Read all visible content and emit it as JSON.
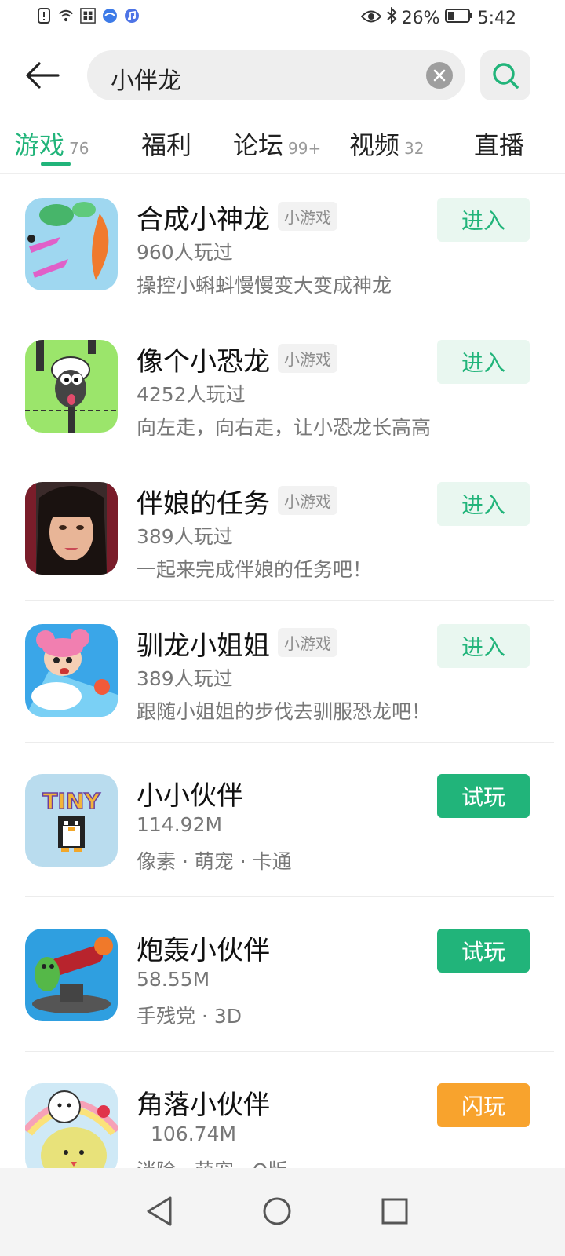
{
  "status": {
    "battery": "26%",
    "time": "5:42",
    "icons": [
      "alert-icon",
      "wifi-icon",
      "game-app-icon",
      "browser-icon",
      "music-icon",
      "eye-icon",
      "bluetooth-icon",
      "battery-icon"
    ]
  },
  "search": {
    "query": "小伴龙",
    "clear_icon": "close-icon",
    "search_icon": "search-icon"
  },
  "tabs": [
    {
      "label": "游戏",
      "count": "76"
    },
    {
      "label": "福利",
      "count": ""
    },
    {
      "label": "论坛",
      "count": "99+"
    },
    {
      "label": "视频",
      "count": "32"
    },
    {
      "label": "直播",
      "count": ""
    }
  ],
  "results": [
    {
      "title": "合成小神龙",
      "tag": "小游戏",
      "meta": "960人玩过",
      "desc": "操控小蝌蚪慢慢变大变成神龙",
      "button": "进入"
    },
    {
      "title": "像个小恐龙",
      "tag": "小游戏",
      "meta": "4252人玩过",
      "desc": "向左走，向右走，让小恐龙长高高",
      "button": "进入"
    },
    {
      "title": "伴娘的任务",
      "tag": "小游戏",
      "meta": "389人玩过",
      "desc": "一起来完成伴娘的任务吧！",
      "button": "进入"
    },
    {
      "title": "驯龙小姐姐",
      "tag": "小游戏",
      "meta": "389人玩过",
      "desc": "跟随小姐姐的步伐去驯服恐龙吧！",
      "button": "进入"
    },
    {
      "title": "小小伙伴",
      "tag": "",
      "meta": "114.92M",
      "desc": "像素 · 萌宠 · 卡通",
      "button": "试玩"
    },
    {
      "title": "炮轰小伙伴",
      "tag": "",
      "meta": "58.55M",
      "desc": "手残党 · 3D",
      "button": "试玩"
    },
    {
      "title": "角落小伙伴",
      "tag": "",
      "meta": "106.74M",
      "desc": "消除 · 萌宠 · Q版",
      "button": "闪玩"
    }
  ],
  "icon_texts": {
    "tiny": "TINY"
  },
  "colors": {
    "accent": "#21b47a",
    "flash": "#f8a32d"
  }
}
